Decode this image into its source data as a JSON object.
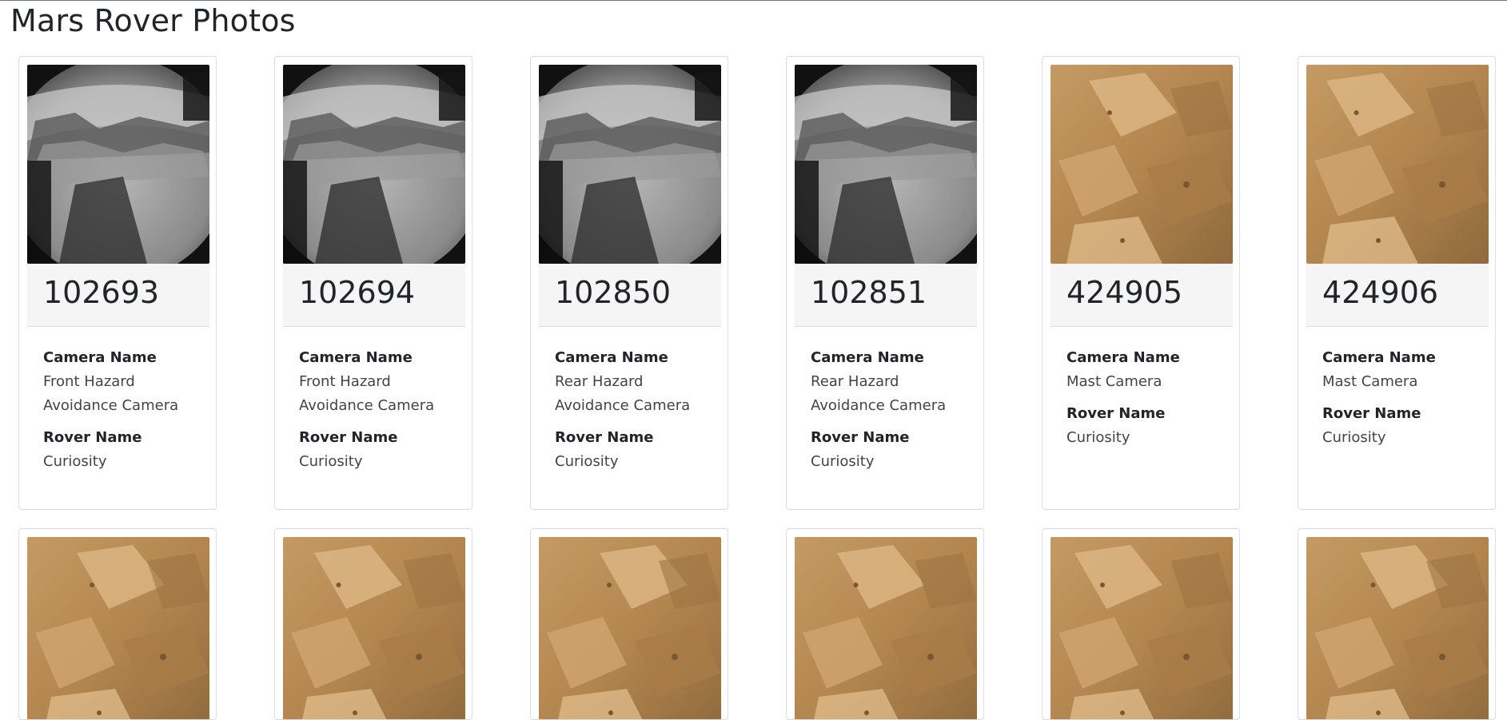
{
  "page": {
    "title": "Mars Rover Photos"
  },
  "labels": {
    "camera_name": "Camera Name",
    "rover_name": "Rover Name"
  },
  "cards": [
    {
      "id": "102693",
      "camera": [
        "Front Hazard",
        "Avoidance Camera"
      ],
      "rover": "Curiosity",
      "photo_type": "hazcam-bw"
    },
    {
      "id": "102694",
      "camera": [
        "Front Hazard",
        "Avoidance Camera"
      ],
      "rover": "Curiosity",
      "photo_type": "hazcam-bw"
    },
    {
      "id": "102850",
      "camera": [
        "Rear Hazard",
        "Avoidance Camera"
      ],
      "rover": "Curiosity",
      "photo_type": "hazcam-bw"
    },
    {
      "id": "102851",
      "camera": [
        "Rear Hazard",
        "Avoidance Camera"
      ],
      "rover": "Curiosity",
      "photo_type": "hazcam-bw"
    },
    {
      "id": "424905",
      "camera": [
        "Mast Camera"
      ],
      "rover": "Curiosity",
      "photo_type": "mastcam-color"
    },
    {
      "id": "424906",
      "camera": [
        "Mast Camera"
      ],
      "rover": "Curiosity",
      "photo_type": "mastcam-color"
    },
    {
      "photo_type": "mastcam-color"
    },
    {
      "photo_type": "mastcam-color"
    },
    {
      "photo_type": "mastcam-color"
    },
    {
      "photo_type": "mastcam-color"
    },
    {
      "photo_type": "mastcam-color"
    },
    {
      "photo_type": "mastcam-color"
    }
  ],
  "colors": {
    "mars_sand": "#b88a55",
    "mars_rock": "#d7ae79",
    "hazcam_sky": "#e8e8e8",
    "hazcam_ground": "#8e8e8e"
  }
}
